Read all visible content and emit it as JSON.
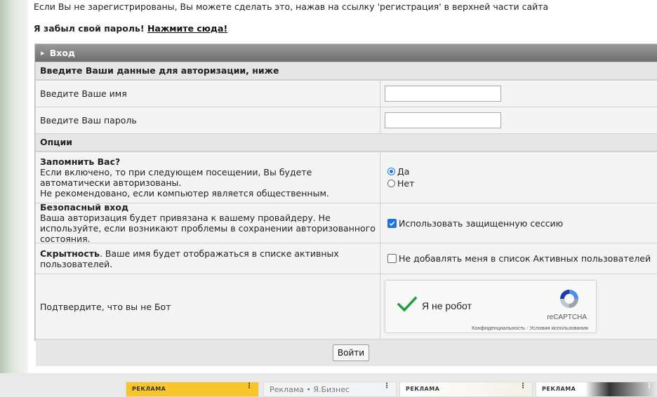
{
  "intro_text": "Если Вы не зарегистрированы, Вы можете сделать это, нажав на ссылку 'регистрация' в верхней части сайта",
  "forgot": {
    "text": "Я забыл свой пароль!",
    "link": "Нажмите сюда!"
  },
  "login_box": {
    "title": "Вход",
    "credentials_heading": "Введите Ваши данные для авторизации, ниже",
    "username_label": "Введите Ваше имя",
    "username_value": "",
    "password_label": "Введите Ваш пароль",
    "password_value": "",
    "options_heading": "Опции",
    "remember": {
      "title": "Запомнить Вас?",
      "desc1": "Если включено, то при следующем посещении, Вы будете автоматически авторизованы.",
      "desc2": "Не рекомендовано, если компьютер является общественным.",
      "yes": "Да",
      "no": "Нет",
      "selected": "Да"
    },
    "secure": {
      "title": "Безопасный вход",
      "desc": "Ваша авторизация будет привязана к вашему провайдеру. Не используйте, если возникают проблемы в сохранении авторизованного состояния.",
      "checkbox_label": "Использовать защищенную сессию",
      "checked": true
    },
    "hidden": {
      "title": "Скрытность",
      "desc": ". Ваше имя будет отображаться в списке активных пользователей.",
      "checkbox_label": "Не добавлять меня в список Активных пользователей",
      "checked": false
    },
    "captcha": {
      "label": "Подтвердите, что вы не Бот",
      "widget_text": "Я не робот",
      "brand": "reCAPTCHA",
      "terms": "Конфиденциальность - Условия использования"
    },
    "submit_label": "Войти"
  },
  "ads": [
    {
      "label": "РЕКЛАМА"
    },
    {
      "label": "Реклама • Я.Бизнес"
    },
    {
      "label": "РЕКЛАМА"
    },
    {
      "label": "РЕКЛАМА"
    }
  ],
  "colors": {
    "header": "#7a7a7a",
    "accent": "#1a73e8",
    "check_green": "#1e9e3e"
  },
  "icons": [
    "caret-right-icon",
    "check-icon",
    "recaptcha-logo-icon",
    "more-icon"
  ]
}
